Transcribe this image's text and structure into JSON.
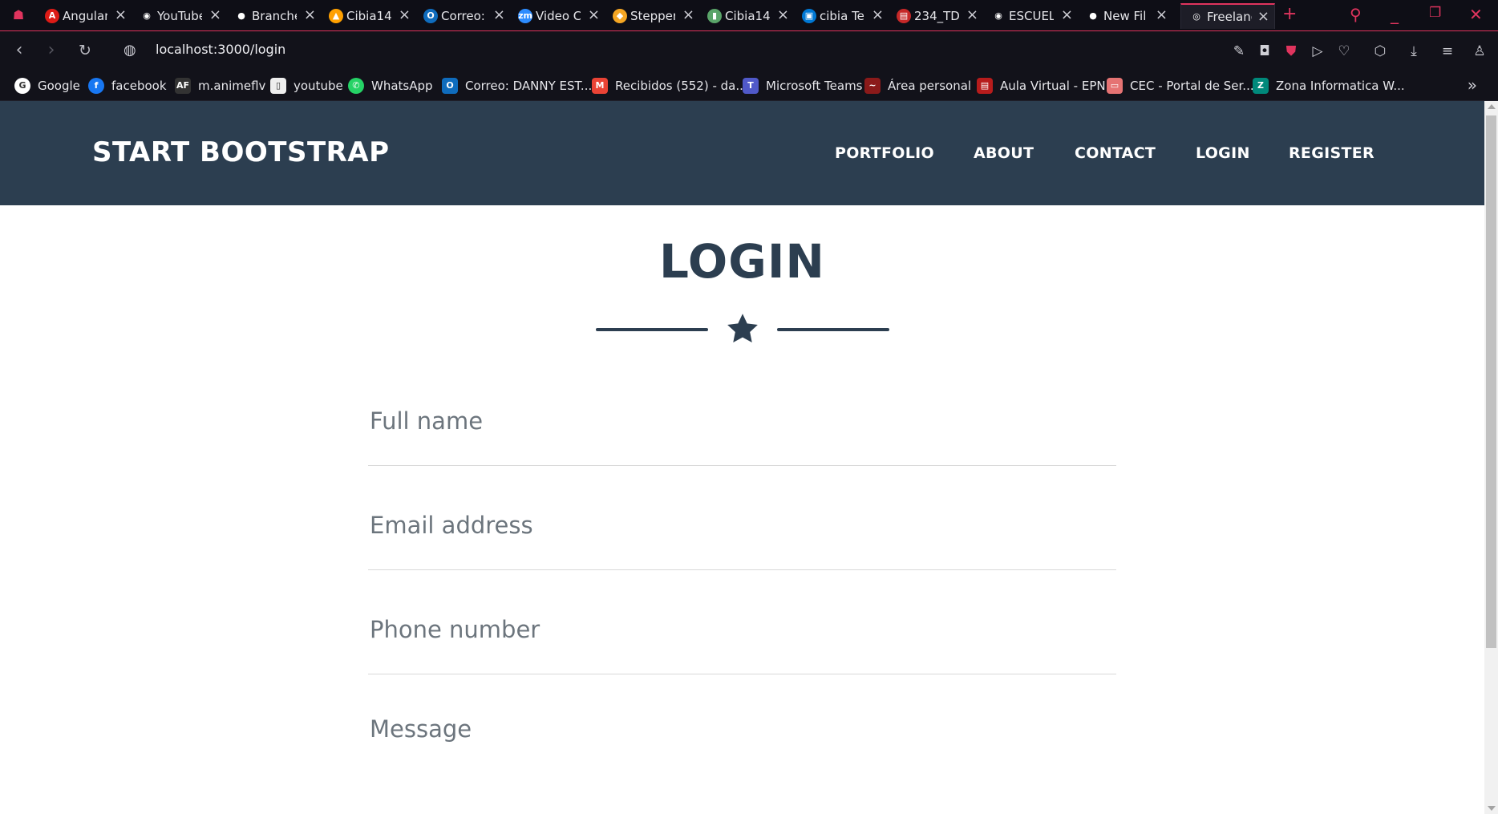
{
  "browser": {
    "tabs": [
      {
        "label": "Angular",
        "icon": "angular-icon",
        "color": "#dd1b16",
        "glyph": "A"
      },
      {
        "label": "YouTube",
        "icon": "globe-icon",
        "color": "#ffffff",
        "glyph": "◉"
      },
      {
        "label": "Branches",
        "icon": "github-icon",
        "color": "#ffffff",
        "glyph": "●"
      },
      {
        "label": "Cibia14",
        "icon": "firebase-icon",
        "color": "#ffa000",
        "glyph": "▲"
      },
      {
        "label": "Correo:",
        "icon": "outlook-icon",
        "color": "#0f6cbd",
        "glyph": "O"
      },
      {
        "label": "Video C",
        "icon": "zoom-icon",
        "color": "#2d8cff",
        "glyph": "zm"
      },
      {
        "label": "Stepper",
        "icon": "shield-icon",
        "color": "#f5a623",
        "glyph": "◆"
      },
      {
        "label": "Cibia14",
        "icon": "chart-icon",
        "color": "#5aa469",
        "glyph": "▮"
      },
      {
        "label": "cibia Te",
        "icon": "azure-devops-icon",
        "color": "#0078d4",
        "glyph": "▣"
      },
      {
        "label": "234_TD",
        "icon": "document-icon",
        "color": "#c62828",
        "glyph": "▤"
      },
      {
        "label": "ESCUEL",
        "icon": "globe-icon",
        "color": "#ffffff",
        "glyph": "◉"
      },
      {
        "label": "New Fil",
        "icon": "github-icon",
        "color": "#ffffff",
        "glyph": "●"
      },
      {
        "label": "Freelanc",
        "icon": "globe-icon",
        "color": "#ffffff",
        "glyph": "◎",
        "active": true
      }
    ],
    "address": "localhost:3000/login",
    "bookmarks": [
      {
        "label": "Google",
        "icon": "google-icon",
        "color": "#ffffff",
        "glyph": "G"
      },
      {
        "label": "facebook",
        "icon": "facebook-icon",
        "color": "#1877f2",
        "glyph": "f"
      },
      {
        "label": "m.animeflv",
        "icon": "animeflv-icon",
        "color": "#333333",
        "glyph": "AF"
      },
      {
        "label": "youtube",
        "icon": "file-icon",
        "color": "#eeeeee",
        "glyph": "▯"
      },
      {
        "label": "WhatsApp",
        "icon": "whatsapp-icon",
        "color": "#25d366",
        "glyph": "✆"
      },
      {
        "label": "Correo: DANNY EST...",
        "icon": "outlook-icon",
        "color": "#0f6cbd",
        "glyph": "O"
      },
      {
        "label": "Recibidos (552) - da...",
        "icon": "gmail-icon",
        "color": "#ea4335",
        "glyph": "M"
      },
      {
        "label": "Microsoft Teams",
        "icon": "teams-icon",
        "color": "#5059c9",
        "glyph": "T"
      },
      {
        "label": "Área personal",
        "icon": "moodle-icon",
        "color": "#8b1a1a",
        "glyph": "~"
      },
      {
        "label": "Aula Virtual - EPN",
        "icon": "epn-icon",
        "color": "#b71c1c",
        "glyph": "▤"
      },
      {
        "label": "CEC - Portal de Ser...",
        "icon": "cec-icon",
        "color": "#e57373",
        "glyph": "▭"
      },
      {
        "label": "Zona Informatica W...",
        "icon": "zona-icon",
        "color": "#00897b",
        "glyph": "Z"
      }
    ]
  },
  "site": {
    "brand": "START BOOTSTRAP",
    "nav": [
      "PORTFOLIO",
      "ABOUT",
      "CONTACT",
      "LOGIN",
      "REGISTER"
    ],
    "heading": "LOGIN",
    "form": {
      "full_name_placeholder": "Full name",
      "email_placeholder": "Email address",
      "phone_placeholder": "Phone number",
      "message_placeholder": "Message"
    },
    "colors": {
      "navbar": "#2c3e50",
      "accent": "#e0345e"
    }
  }
}
